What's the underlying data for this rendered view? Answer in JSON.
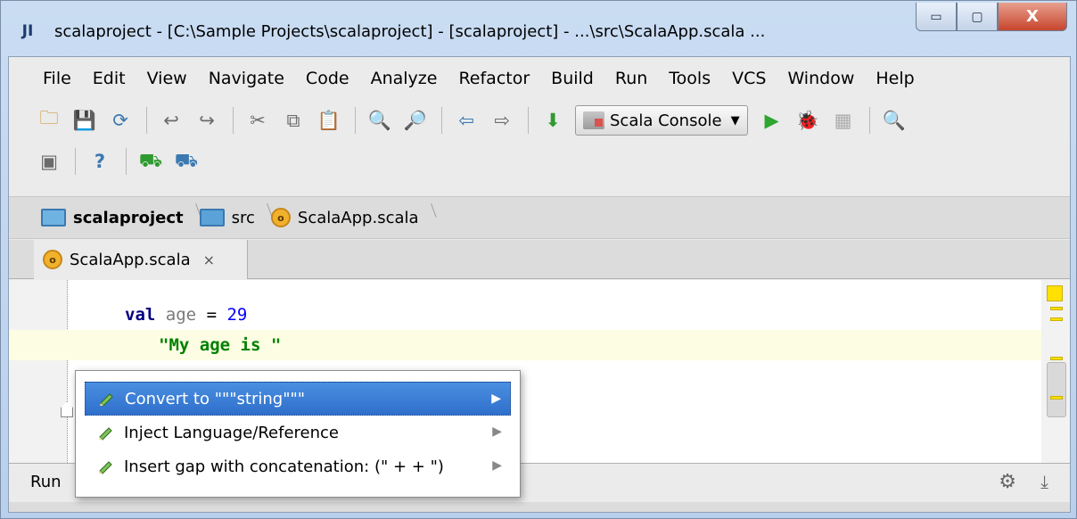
{
  "window": {
    "title": "scalaproject - [C:\\Sample Projects\\scalaproject] - [scalaproject] - ...\\src\\ScalaApp.scala ...",
    "app_icon": "JI",
    "buttons": {
      "minimize": "▭",
      "maximize": "▢",
      "close": "X"
    }
  },
  "menu": [
    "File",
    "Edit",
    "View",
    "Navigate",
    "Code",
    "Analyze",
    "Refactor",
    "Build",
    "Run",
    "Tools",
    "VCS",
    "Window",
    "Help"
  ],
  "toolbar": {
    "run_config_label": "Scala Console",
    "run_config_arrow": "▼",
    "icons": {
      "open": "🗀",
      "save": "💾",
      "sync": "⟳",
      "undo": "↩",
      "redo": "↪",
      "cut": "✂",
      "copy": "⧉",
      "paste": "📋",
      "find": "🔍",
      "replace": "🔎",
      "back": "⇦",
      "forward": "⇨",
      "make": "⬇",
      "run": "▶",
      "debug": "🐞",
      "coverage": "▦",
      "search": "🔍",
      "structure": "▣",
      "help": "?",
      "sdk1": "⛟",
      "sdk2": "⛟"
    }
  },
  "breadcrumb": {
    "project": "scalaproject",
    "folder": "src",
    "file": "ScalaApp.scala",
    "file_icon_letter": "o"
  },
  "editor_tab": {
    "label": "ScalaApp.scala",
    "icon_letter": "o",
    "close": "×"
  },
  "code": {
    "line1": {
      "keyword": "val",
      "ident": "age",
      "op": "=",
      "number": "29"
    },
    "line2": {
      "string": "\"My age is \""
    }
  },
  "popup": {
    "items": [
      {
        "label": "Convert to \"\"\"string\"\"\"",
        "arrow": "▶"
      },
      {
        "label": "Inject Language/Reference",
        "arrow": "▶"
      },
      {
        "label": "Insert gap with concatenation: (\" + + \")",
        "arrow": "▶"
      }
    ]
  },
  "bottom": {
    "run_label": "Run",
    "gear": "⚙",
    "pin": "⤓"
  }
}
